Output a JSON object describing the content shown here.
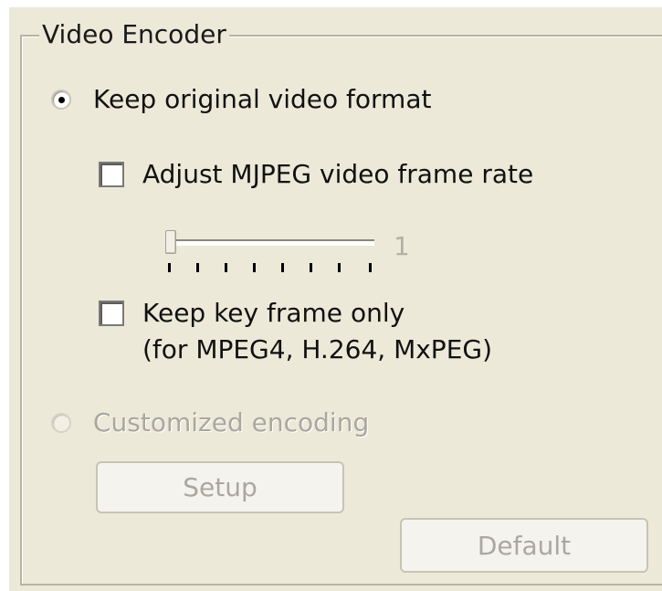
{
  "group": {
    "title": "Video Encoder"
  },
  "options": {
    "keep_original_label": "Keep original video format",
    "adjust_mjpeg_label": "Adjust MJPEG video frame rate",
    "frame_rate_value": "1",
    "keep_key_frame_label": "Keep key frame only",
    "keep_key_frame_note": "(for MPEG4, H.264, MxPEG)",
    "customized_label": "Customized encoding"
  },
  "state": {
    "keep_original_selected": true,
    "customized_selected": false,
    "customized_enabled": false,
    "adjust_mjpeg_checked": false,
    "keep_key_frame_checked": false,
    "frame_rate_slider_position": 0
  },
  "buttons": {
    "setup_label": "Setup",
    "default_label": "Default"
  }
}
